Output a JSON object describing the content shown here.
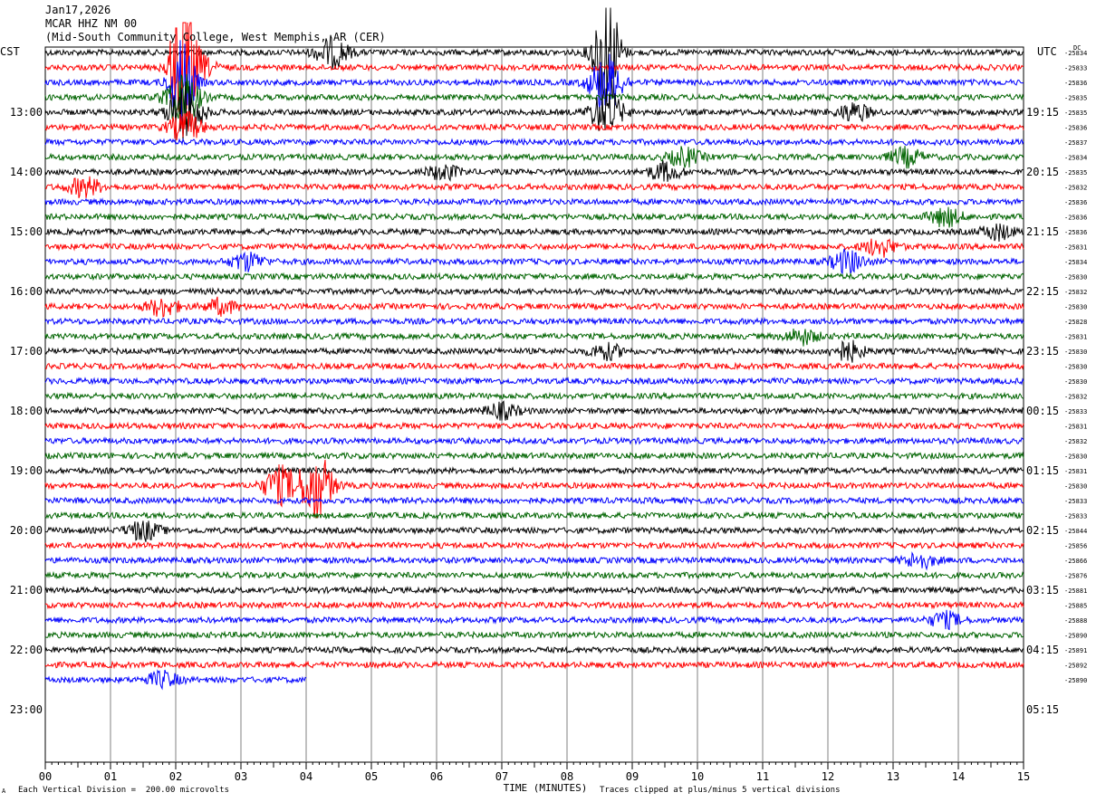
{
  "header": {
    "date": "Jan17,2026",
    "station": "MCAR HHZ NM 00",
    "location": "(Mid-South Community College, West Memphis, AR (CER)"
  },
  "left_timezone": "CST",
  "right_timezone": "UTC",
  "dc_label": "DC",
  "footer": {
    "scale": "Each Vertical Division =  200.00 microvolts",
    "clip": "Traces clipped at plus/minus 5 vertical divisions",
    "corner": "A"
  },
  "chart_data": {
    "type": "line",
    "title": "",
    "xlabel": "TIME (MINUTES)",
    "ylabel": "",
    "x_ticks": [
      "00",
      "01",
      "02",
      "03",
      "04",
      "05",
      "06",
      "07",
      "08",
      "09",
      "10",
      "11",
      "12",
      "13",
      "14",
      "15"
    ],
    "xlim": [
      0,
      15
    ],
    "trace_minutes": 15,
    "left_hour_labels": [
      "13:00",
      "14:00",
      "15:00",
      "16:00",
      "17:00",
      "18:00",
      "19:00",
      "20:00",
      "21:00",
      "22:00",
      "23:00"
    ],
    "right_hour_labels": [
      "19:15",
      "20:15",
      "21:15",
      "22:15",
      "23:15",
      "00:15",
      "01:15",
      "02:15",
      "03:15",
      "04:15",
      "05:15"
    ],
    "series_colors": [
      "#000000",
      "#ff0000",
      "#0000ff",
      "#006400"
    ],
    "dc_offsets": [
      "25834",
      "25833",
      "25836",
      "25835",
      "25835",
      "25836",
      "25837",
      "25834",
      "25835",
      "25832",
      "25836",
      "25836",
      "25836",
      "25831",
      "25834",
      "25830",
      "25832",
      "25830",
      "25828",
      "25831",
      "25830",
      "25830",
      "25830",
      "25832",
      "25833",
      "25831",
      "25832",
      "25830",
      "25831",
      "25830",
      "25833",
      "25833",
      "25844",
      "25856",
      "25866",
      "25876",
      "25881",
      "25885",
      "25888",
      "25890",
      "25891",
      "25892",
      "25890"
    ],
    "last_trace_end_minute": 4.0,
    "events": [
      {
        "trace": 0,
        "minute": 4.4,
        "amp": 2.0
      },
      {
        "trace": 0,
        "minute": 8.6,
        "amp": 10
      },
      {
        "trace": 1,
        "minute": 2.1,
        "amp": 10
      },
      {
        "trace": 1,
        "minute": 2.35,
        "amp": 1.5
      },
      {
        "trace": 2,
        "minute": 2.1,
        "amp": 6
      },
      {
        "trace": 2,
        "minute": 8.6,
        "amp": 4
      },
      {
        "trace": 3,
        "minute": 2.1,
        "amp": 4
      },
      {
        "trace": 4,
        "minute": 2.15,
        "amp": 4
      },
      {
        "trace": 4,
        "minute": 8.6,
        "amp": 3
      },
      {
        "trace": 4,
        "minute": 12.4,
        "amp": 1.2
      },
      {
        "trace": 5,
        "minute": 2.15,
        "amp": 2
      },
      {
        "trace": 7,
        "minute": 9.8,
        "amp": 1.2
      },
      {
        "trace": 7,
        "minute": 13.2,
        "amp": 1.2
      },
      {
        "trace": 8,
        "minute": 6.1,
        "amp": 1.0
      },
      {
        "trace": 8,
        "minute": 9.5,
        "amp": 1.2
      },
      {
        "trace": 9,
        "minute": 0.6,
        "amp": 1.3
      },
      {
        "trace": 11,
        "minute": 13.8,
        "amp": 1.2
      },
      {
        "trace": 12,
        "minute": 14.6,
        "amp": 1.0
      },
      {
        "trace": 13,
        "minute": 12.8,
        "amp": 1.2
      },
      {
        "trace": 14,
        "minute": 3.1,
        "amp": 1.2
      },
      {
        "trace": 14,
        "minute": 12.3,
        "amp": 1.5
      },
      {
        "trace": 17,
        "minute": 1.8,
        "amp": 1.2
      },
      {
        "trace": 17,
        "minute": 2.7,
        "amp": 1.0
      },
      {
        "trace": 19,
        "minute": 11.6,
        "amp": 1.0
      },
      {
        "trace": 20,
        "minute": 12.3,
        "amp": 1.3
      },
      {
        "trace": 20,
        "minute": 8.6,
        "amp": 1.0
      },
      {
        "trace": 24,
        "minute": 7.0,
        "amp": 1.0
      },
      {
        "trace": 29,
        "minute": 3.6,
        "amp": 2.5
      },
      {
        "trace": 29,
        "minute": 4.15,
        "amp": 4.5
      },
      {
        "trace": 32,
        "minute": 1.5,
        "amp": 1.3
      },
      {
        "trace": 34,
        "minute": 13.4,
        "amp": 1.0
      },
      {
        "trace": 38,
        "minute": 13.8,
        "amp": 1.0
      },
      {
        "trace": 42,
        "minute": 1.8,
        "amp": 1.0
      }
    ]
  }
}
